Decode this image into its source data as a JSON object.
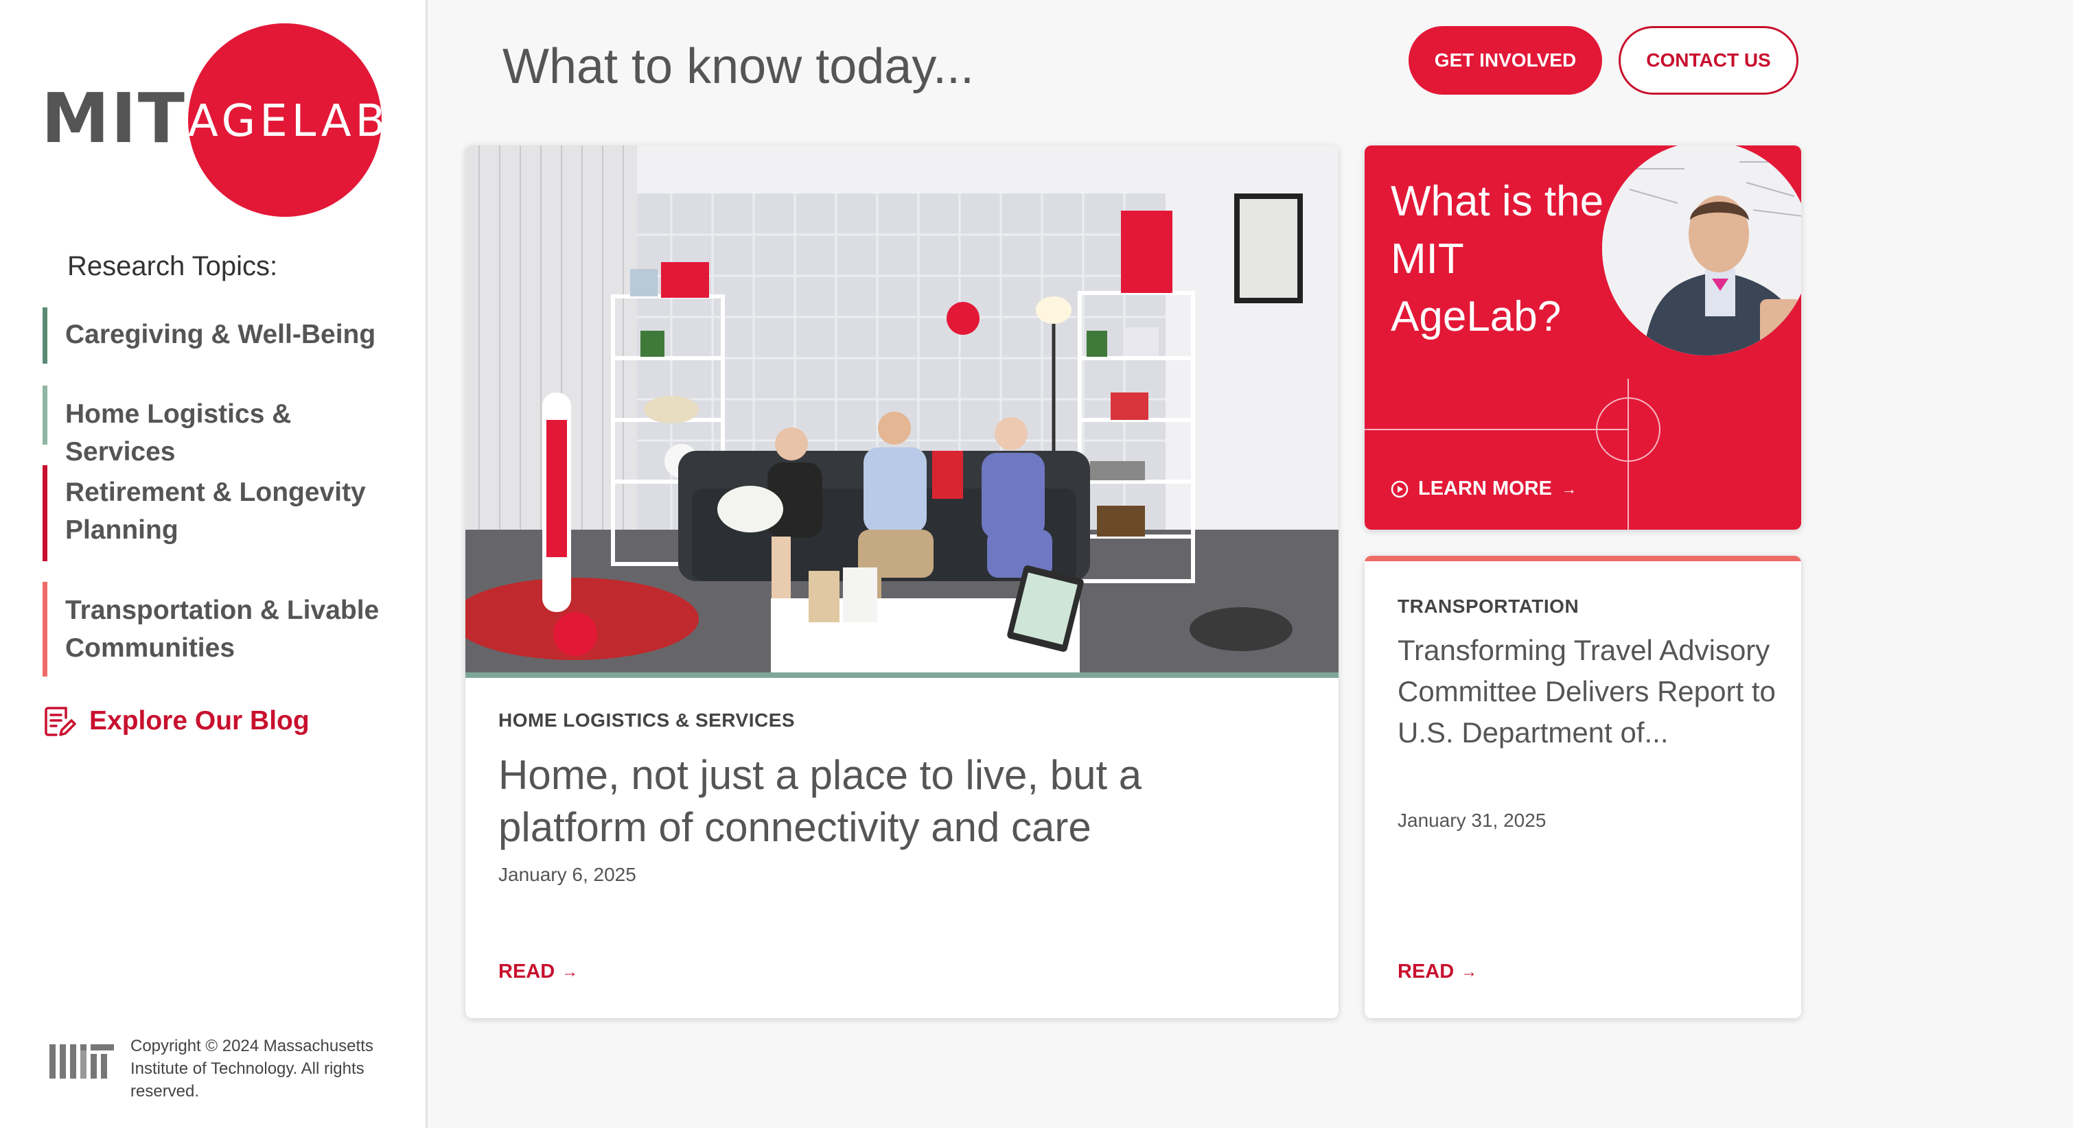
{
  "sidebar": {
    "logo": {
      "mit": "MIT",
      "agelab": "AGELAB"
    },
    "research_heading": "Research Topics:",
    "topics": [
      {
        "label": "Caregiving & Well-Being",
        "color": "#5b8a75"
      },
      {
        "label": "Home Logistics & Services",
        "color": "#8fb5a3"
      },
      {
        "label": "Retirement & Longevity Planning",
        "color": "#c8102e"
      },
      {
        "label": "Transportation & Livable Communities",
        "color": "#ef6c66"
      }
    ],
    "blog_link": "Explore Our Blog",
    "copyright": "Copyright © 2024 Massachusetts Institute of Technology. All rights reserved."
  },
  "header": {
    "title": "What to know today...",
    "primary_button": "GET INVOLVED",
    "secondary_button": "CONTACT US"
  },
  "featured_article": {
    "category": "HOME LOGISTICS & SERVICES",
    "title": "Home, not just a place to live, but a platform of connectivity and care",
    "date": "January 6, 2025",
    "read_label": "READ",
    "accent": "#7fa797"
  },
  "promo": {
    "text": "What is the MIT AgeLab?",
    "link": "LEARN MORE"
  },
  "side_article": {
    "category": "TRANSPORTATION",
    "title": "Transforming Travel Advisory Committee Delivers Report to U.S. Department of...",
    "date": "January 31, 2025",
    "read_label": "READ",
    "accent": "#ef6c66"
  },
  "colors": {
    "brand_red": "#e31837",
    "text_gray": "#555555",
    "background": "#f7f7f7"
  }
}
